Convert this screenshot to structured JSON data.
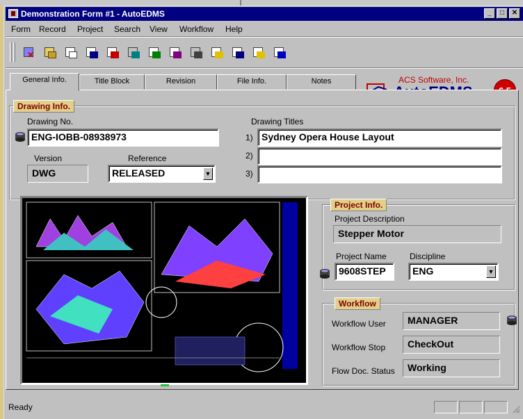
{
  "window": {
    "title": "Demonstration Form #1 - AutoEDMS",
    "controls": {
      "minimize": "_",
      "maximize": "□",
      "close": "✕"
    }
  },
  "menu": [
    "Form",
    "Record",
    "Project",
    "Search",
    "View",
    "Workflow",
    "Help"
  ],
  "toolbar": {
    "icons": [
      "delete-record-icon",
      "open-folder-icon",
      "copy-record-icon",
      "print-form-icon",
      "edit-record-icon",
      "hierarchy-icon",
      "viewer-icon",
      "redline-icon",
      "sign-off-icon",
      "check-icon",
      "report-icon",
      "attach-icon",
      "email-icon"
    ]
  },
  "tabs": [
    "General Info.",
    "Title Block",
    "Revision",
    "File Info.",
    "Notes"
  ],
  "active_tab": "General Info.",
  "logo": {
    "company": "ACS Software, Inc.",
    "product": "AutoEDMS",
    "version": "6.5"
  },
  "drawing_info": {
    "section_label": "Drawing Info.",
    "drawing_no_label": "Drawing No.",
    "drawing_no": "ENG-IOBB-08938973",
    "version_label": "Version",
    "version": "DWG",
    "reference_label": "Reference",
    "reference": "RELEASED",
    "titles_label": "Drawing Titles",
    "titles": [
      {
        "num": "1)",
        "value": "Sydney Opera House Layout"
      },
      {
        "num": "2)",
        "value": ""
      },
      {
        "num": "3)",
        "value": ""
      }
    ]
  },
  "project_info": {
    "section_label": "Project Info.",
    "description_label": "Project Description",
    "description": "Stepper Motor",
    "name_label": "Project Name",
    "name": "9608STEP",
    "discipline_label": "Discipline",
    "discipline": "ENG"
  },
  "workflow": {
    "section_label": "Workflow",
    "user_label": "Workflow User",
    "user": "MANAGER",
    "stop_label": "Workflow Stop",
    "stop": "CheckOut",
    "status_label": "Flow Doc. Status",
    "status": "Working"
  },
  "status": {
    "text": "Ready"
  },
  "colors": {
    "title_bar": "#000080",
    "section_label_bg": "#e2d08a",
    "section_label_text": "#800000",
    "logo_blue": "#000080",
    "logo_red": "#d00000"
  }
}
